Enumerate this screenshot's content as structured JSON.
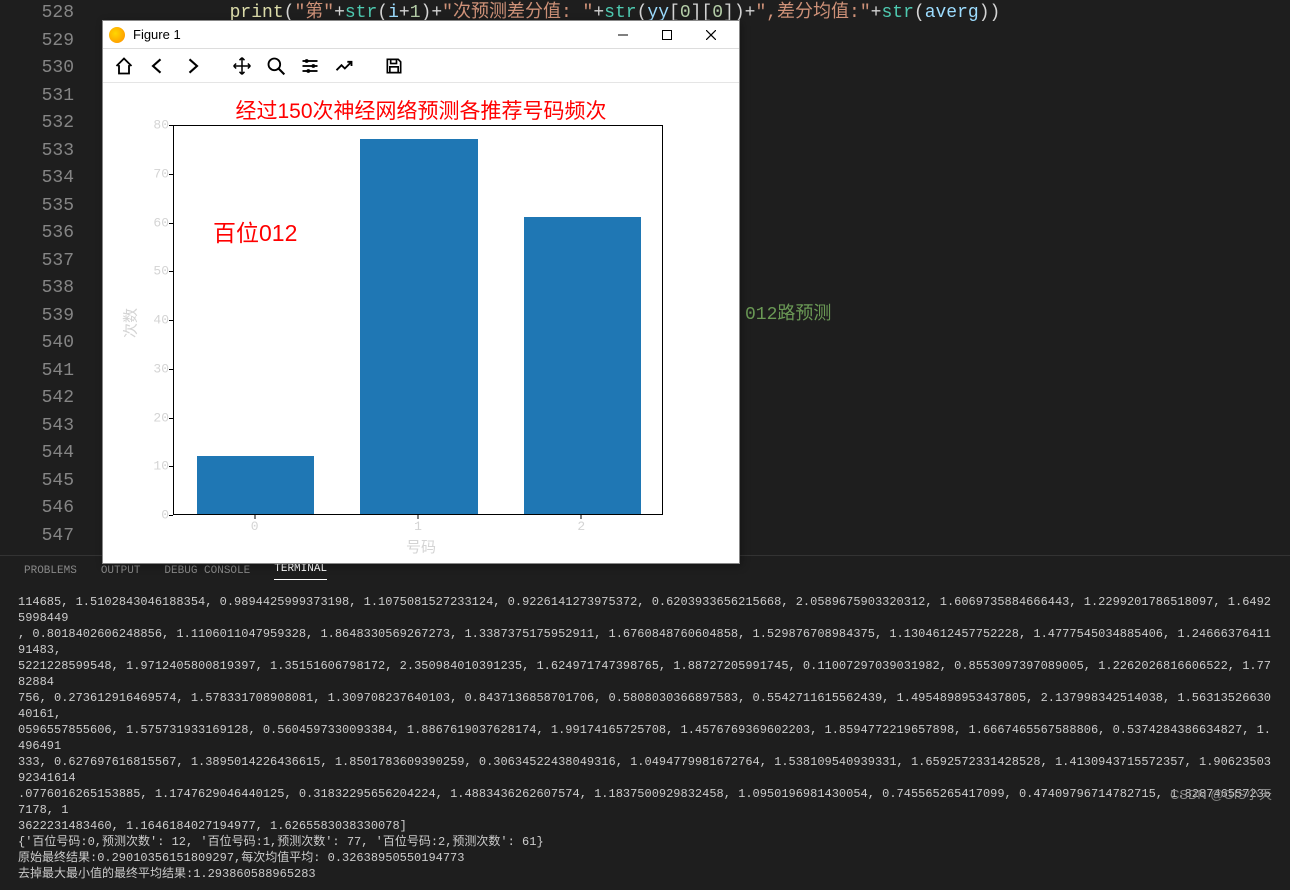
{
  "editor": {
    "line_numbers": [
      "528",
      "529",
      "530",
      "531",
      "532",
      "533",
      "534",
      "535",
      "536",
      "537",
      "538",
      "539",
      "540",
      "541",
      "542",
      "543",
      "544",
      "545",
      "546",
      "547"
    ],
    "code_line_528": "print(\"第\"+str(i+1)+\"次预测差分值: \"+str(yy[0][0])+\",差分均值:\"+str(averg))",
    "partial_comment": "012路预测"
  },
  "terminal": {
    "tabs": {
      "problems": "PROBLEMS",
      "output": "OUTPUT",
      "debug": "DEBUG CONSOLE",
      "terminal": "TERMINAL"
    },
    "content": "114685, 1.5102843046188354, 0.9894425999373198, 1.1075081527233124, 0.9226141273975372, 0.6203933656215668, 2.0589675903320312, 1.6069735884666443, 1.2299201786518097, 1.64925998449\n, 0.8018402606248856, 1.1106011047959328, 1.8648330569267273, 1.3387375175952911, 1.6760848760604858, 1.529876708984375, 1.1304612457752228, 1.4777545034885406, 1.2466637641191483, \n5221228599548, 1.9712405800819397, 1.35151606798172, 2.350984010391235, 1.624971747398765, 1.88727205991745, 0.11007297039031982, 0.8553097397089005, 1.2262026816606522, 1.7782884\n756, 0.273612916469574, 1.578331708908081, 1.309708237640103, 0.8437136858701706, 0.5808030366897583, 0.5542711615562439, 1.4954898953437805, 2.137998342514038, 1.5631352663040161,\n0596557855606, 1.575731933169128, 0.5604597330093384, 1.8867619037628174, 1.99174165725708, 1.4576769369602203, 1.8594772219657898, 1.6667465567588806, 0.5374284386634827, 1.496491\n333, 0.627697616815567, 1.3895014226436615, 1.8501783609390259, 0.30634522438049316, 1.0494779981672764, 1.538109540939331, 1.6592572331428528, 1.4130943715572357, 1.9062350392341614\n.0776016265153885, 1.1747629046440125, 0.31832295656204224, 1.4883436262607574, 1.1837500929832458, 1.0950196981430054, 0.745565265417099, 0.47409796714782715, 1.8287465572357178, 1\n3622231483460, 1.1646184027194977, 1.6265583038330078]\n{'百位号码:0,预测次数': 12, '百位号码:1,预测次数': 77, '百位号码:2,预测次数': 61}\n原始最终结果:0.29010356151809297,每次均值平均: 0.32638950550194773\n去掉最大最小值的最终平均结果:1.293860588965283"
  },
  "watermark": "CSDN @GIS小天",
  "figure": {
    "title": "Figure 1",
    "toolbar_names": [
      "home",
      "back",
      "forward",
      "pan",
      "zoom",
      "subplots",
      "configure",
      "save"
    ]
  },
  "chart_data": {
    "type": "bar",
    "title": "经过150次神经网络预测各推荐号码频次",
    "annotation": "百位012",
    "xlabel": "号码",
    "ylabel": "次数",
    "categories": [
      "0",
      "1",
      "2"
    ],
    "values": [
      12,
      77,
      61
    ],
    "ylim": [
      0,
      80
    ],
    "yticks": [
      0,
      10,
      20,
      30,
      40,
      50,
      60,
      70,
      80
    ]
  }
}
